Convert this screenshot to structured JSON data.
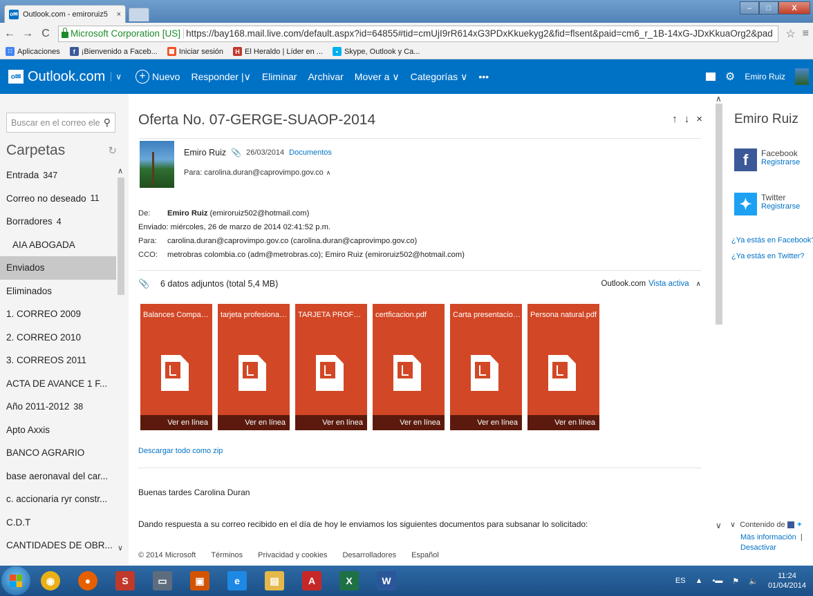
{
  "browser": {
    "tab_title": "Outlook.com - emiroruiz5",
    "tab_favicon": "o✉",
    "tab_close": "×",
    "ev_label": "Microsoft Corporation [US]",
    "url": "https://bay168.mail.live.com/default.aspx?id=64855#tid=cmUjI9rR614xG3PDxKkuekyg2&fid=flsent&paid=cm6_r_1B-14xG-JDxKkuaOrg2&pad",
    "back": "←",
    "forward": "→",
    "reload": "C",
    "star": "☆",
    "menu": "≡",
    "bookmarks": [
      {
        "label": "Aplicaciones",
        "icon": "apps-grid-icon",
        "color": "#4285f4",
        "glyph": "∷"
      },
      {
        "label": "¡Bienvenido a Faceb...",
        "icon": "facebook-icon",
        "color": "#3b5998",
        "glyph": "f"
      },
      {
        "label": "Iniciar sesión",
        "icon": "microsoft-icon",
        "color": "#f25022",
        "glyph": "▦"
      },
      {
        "label": "El Heraldo | Líder en ...",
        "icon": "heraldo-icon",
        "color": "#c0392b",
        "glyph": "H"
      },
      {
        "label": "Skype, Outlook y Ca...",
        "icon": "skype-leaf-icon",
        "color": "#00aff0",
        "glyph": "•"
      }
    ]
  },
  "outlook": {
    "brand": "Outlook.com",
    "brand_logo": "o✉",
    "brand_chevron": "∨",
    "commands": {
      "new": "Nuevo",
      "reply": "Responder",
      "delete": "Eliminar",
      "archive": "Archivar",
      "move": "Mover a",
      "categories": "Categorías",
      "more": "•••"
    },
    "user_name": "Emiro Ruiz",
    "accent": "#0072c6"
  },
  "sidebar": {
    "search_placeholder": "Buscar en el correo ele",
    "folders_title": "Carpetas",
    "folders": [
      {
        "label": "Entrada",
        "count": "347"
      },
      {
        "label": "Correo no deseado",
        "count": "11"
      },
      {
        "label": "Borradores",
        "count": "4"
      },
      {
        "label": "AIA ABOGADA",
        "count": ""
      },
      {
        "label": "Enviados",
        "count": ""
      },
      {
        "label": "Eliminados",
        "count": ""
      },
      {
        "label": "1. CORREO 2009",
        "count": ""
      },
      {
        "label": "2. CORREO 2010",
        "count": ""
      },
      {
        "label": "3. CORREOS 2011",
        "count": ""
      },
      {
        "label": "ACTA DE AVANCE 1 F...",
        "count": ""
      },
      {
        "label": "Año 2011-2012",
        "count": "38"
      },
      {
        "label": "Apto Axxis",
        "count": ""
      },
      {
        "label": "BANCO AGRARIO",
        "count": ""
      },
      {
        "label": "base aeronaval del car...",
        "count": ""
      },
      {
        "label": "c. accionaria ryr constr...",
        "count": ""
      },
      {
        "label": "C.D.T",
        "count": ""
      },
      {
        "label": "CANTIDADES DE OBR...",
        "count": ""
      }
    ]
  },
  "message": {
    "subject": "Oferta No. 07-GERGE-SUAOP-2014",
    "sender": "Emiro Ruiz",
    "date": "26/03/2014",
    "folder": "Documentos",
    "to_short": "Para: carolina.duran@caprovimpo.gov.co",
    "headers": {
      "from_label": "De:",
      "from_name": "Emiro Ruiz",
      "from_email": "(emiroruiz502@hotmail.com)",
      "sent_label": "Enviado:",
      "sent_value": "miércoles, 26 de marzo de 2014 02:41:52 p.m.",
      "to_label": "Para:",
      "to_value": "carolina.duran@caprovimpo.gov.co (carolina.duran@caprovimpo.gov.co)",
      "bcc_label": "CCO:",
      "bcc_value": "metrobras colombia.co (adm@metrobras.co); Emiro Ruiz (emiroruiz502@hotmail.com)"
    },
    "attachments_summary": "6 datos adjuntos (total 5,4 MB)",
    "attachments_source": "Outlook.com",
    "attachments_view": "Vista activa",
    "attachments": [
      {
        "name": "Balances Comparat...",
        "action": "Ver en línea"
      },
      {
        "name": "tarjeta profesional j...",
        "action": "Ver en línea"
      },
      {
        "name": "TARJETA PROFESIO...",
        "action": "Ver en línea"
      },
      {
        "name": "certficacion.pdf",
        "action": "Ver en línea"
      },
      {
        "name": "Carta presentacion....",
        "action": "Ver en línea"
      },
      {
        "name": "Persona natural.pdf",
        "action": "Ver en línea"
      }
    ],
    "download_all": "Descargar todo como zip",
    "greeting": "Buenas tardes Carolina Duran",
    "body": "Dando respuesta a su correo recibido en el día de hoy  le enviamos los siguientes documentos para subsanar lo solicitado:"
  },
  "footer": {
    "copyright": "© 2014 Microsoft",
    "terms": "Términos",
    "privacy": "Privacidad y cookies",
    "developers": "Desarrolladores",
    "language": "Español"
  },
  "people_pane": {
    "name": "Emiro Ruiz",
    "facebook": "Facebook",
    "facebook_action": "Registrarse",
    "twitter": "Twitter",
    "twitter_action": "Registrarse",
    "q_facebook": "¿Ya estás en Facebook?",
    "q_twitter": "¿Ya estás en Twitter?",
    "content_from": "Contenido de",
    "more_info": "Más información",
    "deactivate": "Desactivar"
  },
  "taskbar": {
    "language": "ES",
    "time": "11:24",
    "date": "01/04/2014",
    "apps": [
      {
        "name": "chrome-icon",
        "color": "#e8b016",
        "glyph": "◉"
      },
      {
        "name": "firefox-icon",
        "color": "#e66000",
        "glyph": "●"
      },
      {
        "name": "s-app-icon",
        "color": "#c0392b",
        "glyph": "S"
      },
      {
        "name": "scanner-icon",
        "color": "#5d6d7e",
        "glyph": "▭"
      },
      {
        "name": "media-icon",
        "color": "#d35400",
        "glyph": "▣"
      },
      {
        "name": "ie-icon",
        "color": "#1e88e5",
        "glyph": "e"
      },
      {
        "name": "explorer-icon",
        "color": "#e6b84a",
        "glyph": "▤"
      },
      {
        "name": "acrobat-icon",
        "color": "#c62828",
        "glyph": "A"
      },
      {
        "name": "excel-icon",
        "color": "#1e7145",
        "glyph": "X"
      },
      {
        "name": "word-icon",
        "color": "#2b579a",
        "glyph": "W"
      }
    ]
  }
}
